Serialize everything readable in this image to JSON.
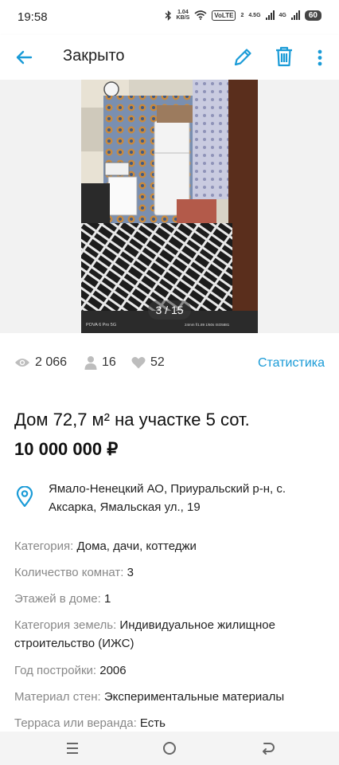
{
  "status_bar": {
    "time": "19:58",
    "net_speed_value": "1.04",
    "net_speed_unit": "KB/S",
    "volte_label": "VoLTE",
    "volte_sim": "2",
    "signal1_label": "4.5G",
    "signal2_label": "4G",
    "battery": "60"
  },
  "app_bar": {
    "title": "Закрыто",
    "back_icon": "arrow-left-icon",
    "edit_icon": "pencil-icon",
    "delete_icon": "trash-icon",
    "more_icon": "more-vertical-icon",
    "accent_color": "#1a9bd7"
  },
  "gallery": {
    "counter": "3 / 15",
    "photo_caption_left": "POVA 6 Pro 5G",
    "photo_caption_right": "24mm f/1.89 1/60s ISO5881"
  },
  "stats": {
    "views": "2 066",
    "contacts": "16",
    "favorites": "52",
    "link_label": "Статистика"
  },
  "listing": {
    "title": "Дом 72,7 м² на участке 5 сот.",
    "price": "10 000 000 ₽"
  },
  "address": {
    "text": "Ямало-Ненецкий АО, Приуральский р-н, с. Аксарка, Ямальская ул., 19"
  },
  "params": [
    {
      "label": "Категория:",
      "value": "Дома, дачи, коттеджи"
    },
    {
      "label": "Количество комнат:",
      "value": "3"
    },
    {
      "label": "Этажей в доме:",
      "value": "1"
    },
    {
      "label": "Категория земель:",
      "value": "Индивидуальное жилищное строительство (ИЖС)"
    },
    {
      "label": "Год постройки:",
      "value": "2006"
    },
    {
      "label": "Материал стен:",
      "value": "Экспериментальные материалы"
    },
    {
      "label": "Терраса или веранда:",
      "value": "Есть"
    }
  ],
  "nav_bar": {
    "menu_icon": "menu-icon",
    "home_icon": "circle-home-icon",
    "back_icon": "back-arrow-icon"
  }
}
